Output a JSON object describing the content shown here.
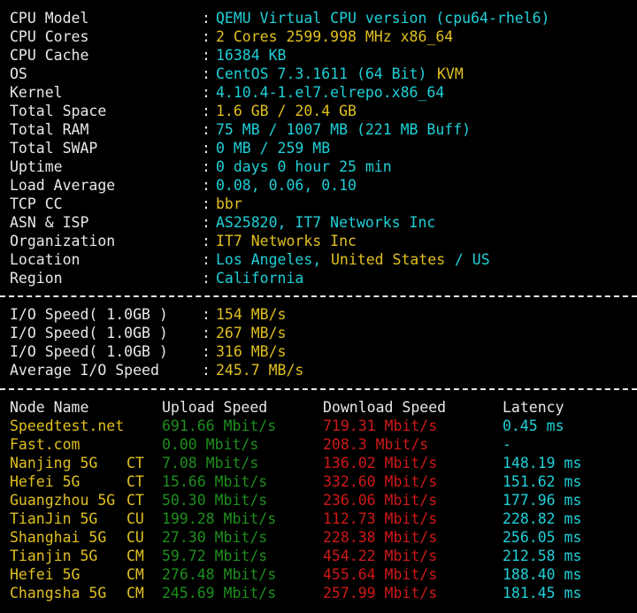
{
  "system_info": [
    {
      "label": "CPU Model",
      "parts": [
        {
          "text": "QEMU Virtual CPU version (cpu64-rhel6)",
          "color": "cyan"
        }
      ]
    },
    {
      "label": "CPU Cores",
      "parts": [
        {
          "text": "2 Cores 2599.998 MHz x86_64",
          "color": "yellow"
        }
      ]
    },
    {
      "label": "CPU Cache",
      "parts": [
        {
          "text": "16384 KB",
          "color": "cyan"
        }
      ]
    },
    {
      "label": "OS",
      "parts": [
        {
          "text": "CentOS 7.3.1611 (64 Bit) ",
          "color": "cyan"
        },
        {
          "text": "KVM",
          "color": "yellow"
        }
      ]
    },
    {
      "label": "Kernel",
      "parts": [
        {
          "text": "4.10.4-1.el7.elrepo.x86_64",
          "color": "cyan"
        }
      ]
    },
    {
      "label": "Total Space",
      "parts": [
        {
          "text": "1.6 GB / 20.4 GB",
          "color": "yellow"
        }
      ]
    },
    {
      "label": "Total RAM",
      "parts": [
        {
          "text": "75 MB / 1007 MB (221 MB Buff)",
          "color": "cyan"
        }
      ]
    },
    {
      "label": "Total SWAP",
      "parts": [
        {
          "text": "0 MB / 259 MB",
          "color": "cyan"
        }
      ]
    },
    {
      "label": "Uptime",
      "parts": [
        {
          "text": "0 days 0 hour 25 min",
          "color": "cyan"
        }
      ]
    },
    {
      "label": "Load Average",
      "parts": [
        {
          "text": "0.08, 0.06, 0.10",
          "color": "cyan"
        }
      ]
    },
    {
      "label": "TCP CC",
      "parts": [
        {
          "text": "bbr",
          "color": "yellow"
        }
      ]
    },
    {
      "label": "ASN & ISP",
      "parts": [
        {
          "text": "AS25820, IT7 Networks Inc",
          "color": "cyan"
        }
      ]
    },
    {
      "label": "Organization",
      "parts": [
        {
          "text": "IT7 Networks Inc",
          "color": "yellow"
        }
      ]
    },
    {
      "label": "Location",
      "parts": [
        {
          "text": "Los Angeles, ",
          "color": "cyan"
        },
        {
          "text": "United States",
          "color": "yellow"
        },
        {
          "text": " / US",
          "color": "cyan"
        }
      ]
    },
    {
      "label": "Region",
      "parts": [
        {
          "text": "California",
          "color": "cyan"
        }
      ]
    }
  ],
  "io_speed": [
    {
      "label": "I/O Speed( 1.0GB )",
      "value": "154 MB/s"
    },
    {
      "label": "I/O Speed( 1.0GB )",
      "value": "267 MB/s"
    },
    {
      "label": "I/O Speed( 1.0GB )",
      "value": "316 MB/s"
    },
    {
      "label": "Average I/O Speed",
      "value": "245.7 MB/s"
    }
  ],
  "separator": ":",
  "speedtest": {
    "headers": {
      "node": "Node Name",
      "upload": "Upload Speed",
      "download": "Download Speed",
      "latency": "Latency"
    },
    "rows": [
      {
        "node": "Speedtest.net",
        "isp": "",
        "upload": "691.66 Mbit/s",
        "download": "719.31 Mbit/s",
        "latency": "0.45 ms"
      },
      {
        "node": "Fast.com",
        "isp": "",
        "upload": "0.00 Mbit/s",
        "download": "208.3 Mbit/s",
        "latency": "-"
      },
      {
        "node": "Nanjing 5G",
        "isp": "CT",
        "upload": "7.08 Mbit/s",
        "download": "136.02 Mbit/s",
        "latency": "148.19 ms"
      },
      {
        "node": "Hefei 5G",
        "isp": "CT",
        "upload": "15.66 Mbit/s",
        "download": "332.60 Mbit/s",
        "latency": "151.62 ms"
      },
      {
        "node": "Guangzhou 5G",
        "isp": "CT",
        "upload": "50.30 Mbit/s",
        "download": "236.06 Mbit/s",
        "latency": "177.96 ms"
      },
      {
        "node": "TianJin 5G",
        "isp": "CU",
        "upload": "199.28 Mbit/s",
        "download": "112.73 Mbit/s",
        "latency": "228.82 ms"
      },
      {
        "node": "Shanghai 5G",
        "isp": "CU",
        "upload": "27.30 Mbit/s",
        "download": "228.38 Mbit/s",
        "latency": "256.05 ms"
      },
      {
        "node": "Tianjin 5G",
        "isp": "CM",
        "upload": "59.72 Mbit/s",
        "download": "454.22 Mbit/s",
        "latency": "212.58 ms"
      },
      {
        "node": "Hefei 5G",
        "isp": "CM",
        "upload": "276.48 Mbit/s",
        "download": "455.64 Mbit/s",
        "latency": "188.40 ms"
      },
      {
        "node": "Changsha 5G",
        "isp": "CM",
        "upload": "245.69 Mbit/s",
        "download": "257.99 Mbit/s",
        "latency": "181.45 ms"
      }
    ]
  },
  "colors": {
    "background": "#000000",
    "label": "#e8e8e8",
    "cyan": "#1fd0d8",
    "yellow": "#e0c020",
    "green": "#1e8f1e",
    "red": "#d01818"
  }
}
